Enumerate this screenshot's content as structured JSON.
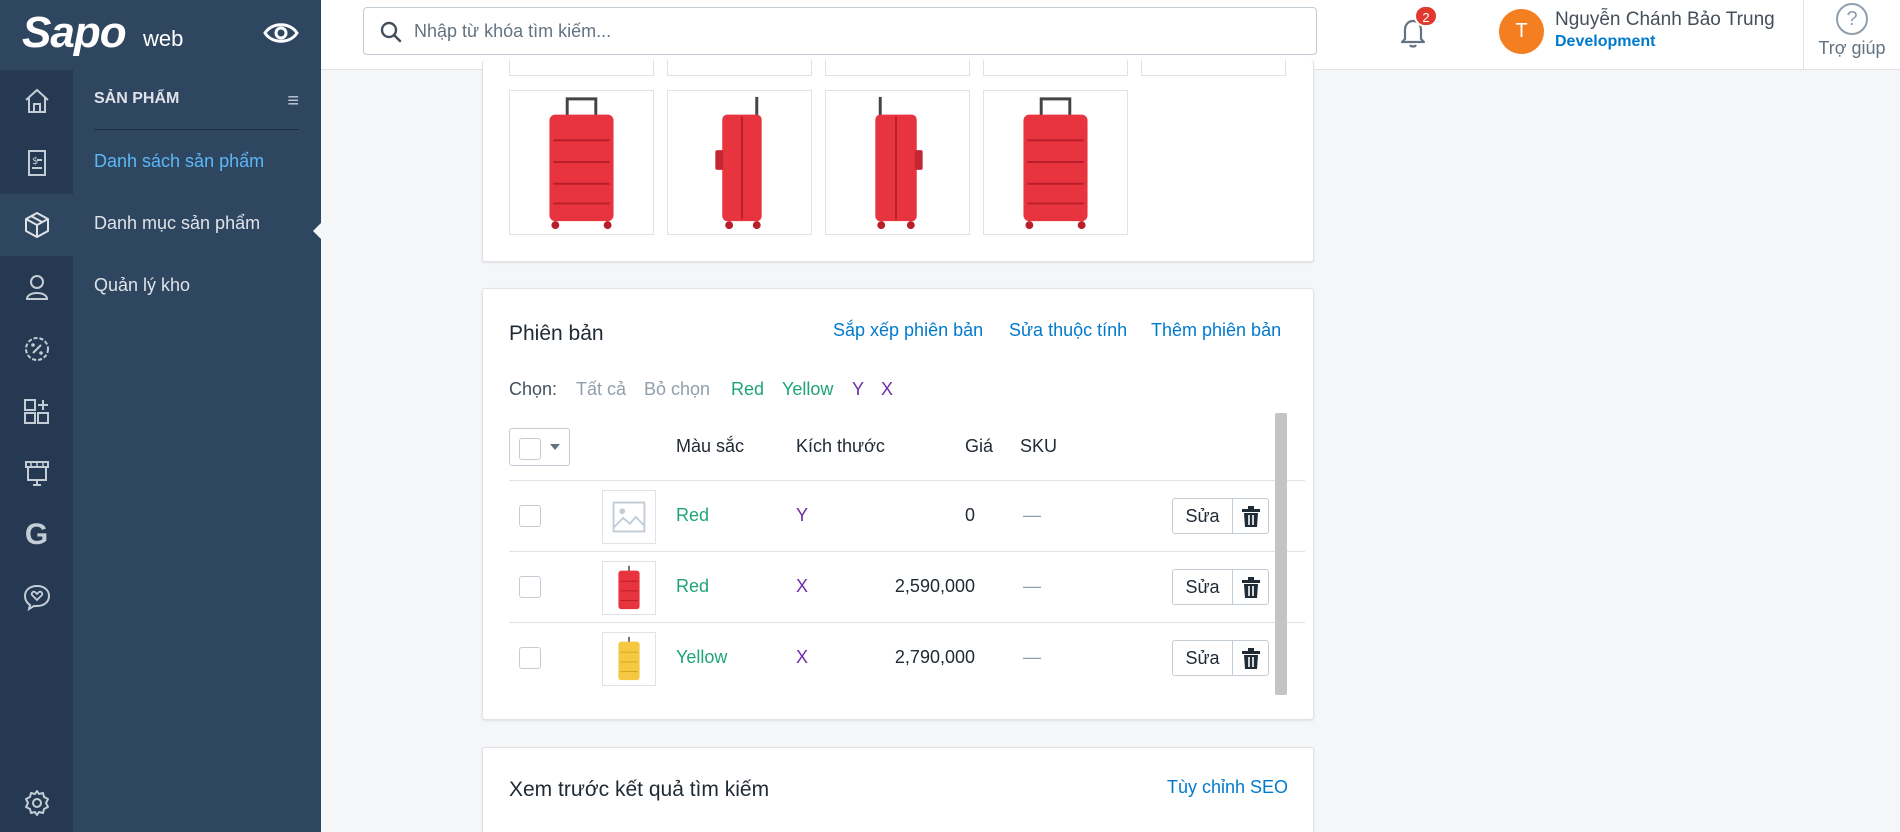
{
  "brand": {
    "logo": "Sapo",
    "logo_suffix": "web"
  },
  "search": {
    "placeholder": "Nhập từ khóa tìm kiếm..."
  },
  "notifications": {
    "count": "2"
  },
  "user": {
    "initial": "T",
    "name": "Nguyễn Chánh Bảo Trung",
    "role": "Development"
  },
  "help": {
    "icon": "?",
    "label": "Trợ giúp"
  },
  "rail": {
    "items": [
      "home-icon",
      "orders-icon",
      "products-icon",
      "customers-icon",
      "discount-icon",
      "apps-icon",
      "store-icon",
      "google-icon",
      "chat-icon",
      "settings-icon"
    ],
    "google_glyph": "G"
  },
  "subnav": {
    "title": "SẢN PHẨM",
    "menu_icon": "≡",
    "items": [
      {
        "label": "Danh sách sản phẩm",
        "active": true
      },
      {
        "label": "Danh mục sản phẩm",
        "active": false
      },
      {
        "label": "Quản lý kho",
        "active": false
      }
    ]
  },
  "media": {
    "images": [
      "red-suitcase-front",
      "red-suitcase-side",
      "red-suitcase-side-2",
      "red-suitcase-front-2"
    ]
  },
  "variants": {
    "title": "Phiên bản",
    "actions": {
      "sort": "Sắp xếp phiên bản",
      "edit_attributes": "Sửa thuộc tính",
      "add": "Thêm phiên bản"
    },
    "filter": {
      "label": "Chọn:",
      "all": "Tất cả",
      "none": "Bỏ chọn",
      "red": "Red",
      "yellow": "Yellow",
      "y": "Y",
      "x": "X"
    },
    "columns": {
      "color": "Màu sắc",
      "size": "Kích thước",
      "price": "Giá",
      "sku": "SKU"
    },
    "rows": [
      {
        "color": "Red",
        "size": "Y",
        "price": "0",
        "sku": "—",
        "image": "placeholder-image",
        "edit": "Sửa"
      },
      {
        "color": "Red",
        "size": "X",
        "price": "2,590,000",
        "sku": "—",
        "image": "red-suitcase",
        "edit": "Sửa"
      },
      {
        "color": "Yellow",
        "size": "X",
        "price": "2,790,000",
        "sku": "—",
        "image": "yellow-suitcase",
        "edit": "Sửa"
      }
    ]
  },
  "seo": {
    "title": "Xem trước kết quả tìm kiếm",
    "action": "Tùy chỉnh SEO"
  },
  "colors": {
    "sidebar": "#2f4661",
    "rail": "#253a52",
    "link": "#007ace",
    "variant_color": "#1fa47a",
    "variant_size": "#6f2da8",
    "avatar": "#f47f20",
    "product": "#e8343f",
    "product_alt": "#f5c842"
  }
}
